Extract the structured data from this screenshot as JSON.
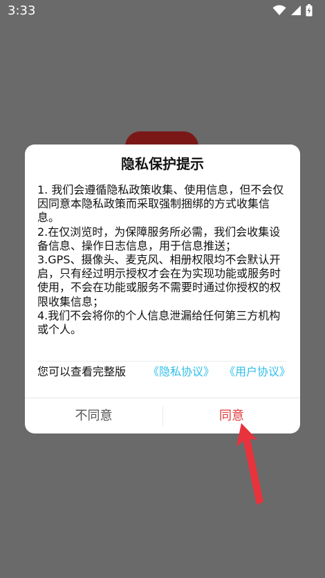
{
  "status_bar": {
    "time": "3:33",
    "icons": [
      "wifi-icon",
      "signal-icon",
      "battery-charging-icon"
    ]
  },
  "dialog": {
    "title": "隐私保护提示",
    "paragraphs": [
      "1. 我们会遵循隐私政策收集、使用信息，但不会仅因同意本隐私政策而采取强制捆绑的方式收集信息。",
      "2.在仅浏览时，为保障服务所必需，我们会收集设备信息、操作日志信息，用于信息推送；",
      "3.GPS、摄像头、麦克风、相册权限均不会默认开启，只有经过明示授权才会在为实现功能或服务时使用，不会在功能或服务不需要时通过你授权的权限收集信息；",
      "4.我们不会将你的个人信息泄漏给任何第三方机构或个人。"
    ],
    "view_label": "您可以查看完整版",
    "privacy_link": "《隐私协议》",
    "user_link": "《用户协议》",
    "disagree_label": "不同意",
    "agree_label": "同意"
  },
  "colors": {
    "backdrop": "#6a6a6a",
    "link": "#2fbfe8",
    "agree": "#e03a3a",
    "arrow": "#e8323c"
  }
}
